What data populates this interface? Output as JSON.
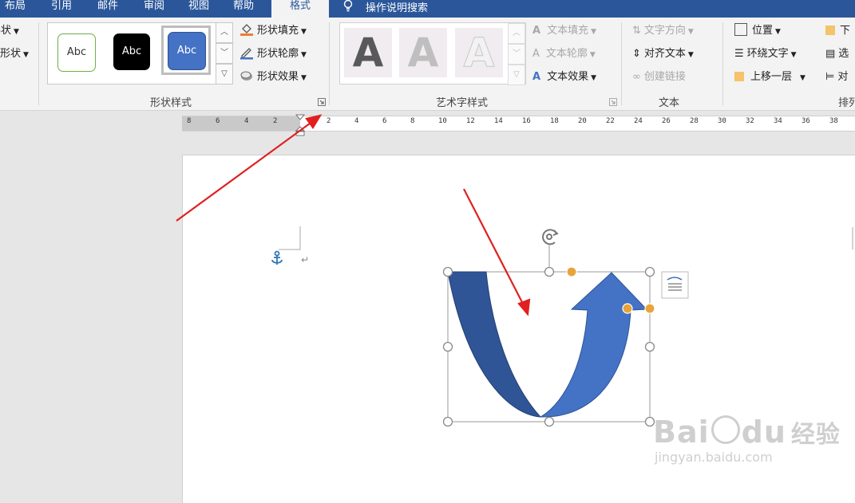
{
  "tabs": [
    {
      "id": "layout",
      "label": "布局"
    },
    {
      "id": "references",
      "label": "引用"
    },
    {
      "id": "mailings",
      "label": "邮件"
    },
    {
      "id": "review",
      "label": "审阅"
    },
    {
      "id": "view",
      "label": "视图"
    },
    {
      "id": "help",
      "label": "帮助"
    },
    {
      "id": "format",
      "label": "格式",
      "active": true
    }
  ],
  "tellme": {
    "label": "操作说明搜索"
  },
  "ribbon": {
    "insert_shapes": {
      "shape_label": "形状",
      "edit_label": "编辑形状"
    },
    "shape_styles": {
      "group_label": "形状样式",
      "styles": [
        {
          "text": "Abc",
          "style": "outline-green"
        },
        {
          "text": "Abc",
          "style": "black-fill"
        },
        {
          "text": "Abc",
          "style": "blue-fill",
          "selected": true
        }
      ],
      "fill": "形状填充",
      "outline": "形状轮廓",
      "effects": "形状效果"
    },
    "wordart": {
      "group_label": "艺术字样式",
      "samples": [
        "A",
        "A",
        "A"
      ],
      "text_fill": "文本填充",
      "text_outline": "文本轮廓",
      "text_effects": "文本效果"
    },
    "text": {
      "group_label": "文本",
      "direction": "文字方向",
      "align": "对齐文本",
      "link": "创建链接"
    },
    "arrange": {
      "group_label": "排列",
      "position": "位置",
      "wrap": "环绕文字",
      "bring_forward": "上移一层",
      "send_backward": "下",
      "selection_pane": "选",
      "align_short": "对"
    }
  },
  "ruler": {
    "left_ticks": [
      "8",
      "6",
      "4",
      "2"
    ],
    "ticks": [
      "2",
      "4",
      "6",
      "8",
      "10",
      "12",
      "14",
      "16",
      "18",
      "20",
      "22",
      "24",
      "26",
      "28",
      "30",
      "32",
      "34",
      "36",
      "38"
    ]
  },
  "watermark": {
    "brand": "Bai",
    "brand2": "du",
    "cn": "经验",
    "url": "jingyan.baidu.com"
  },
  "colors": {
    "tab_blue": "#2b579a",
    "arrow_dark": "#2f5597",
    "arrow_light": "#4472c4",
    "annotation_red": "#e02020",
    "handle_orange": "#e8a33a"
  },
  "icons": {
    "anchor": "anchor-icon",
    "rotate": "rotate-handle-icon",
    "layout_options": "layout-options-icon",
    "dialog_launcher": "dialog-launcher-icon",
    "return_mark": "paragraph-return-icon"
  }
}
